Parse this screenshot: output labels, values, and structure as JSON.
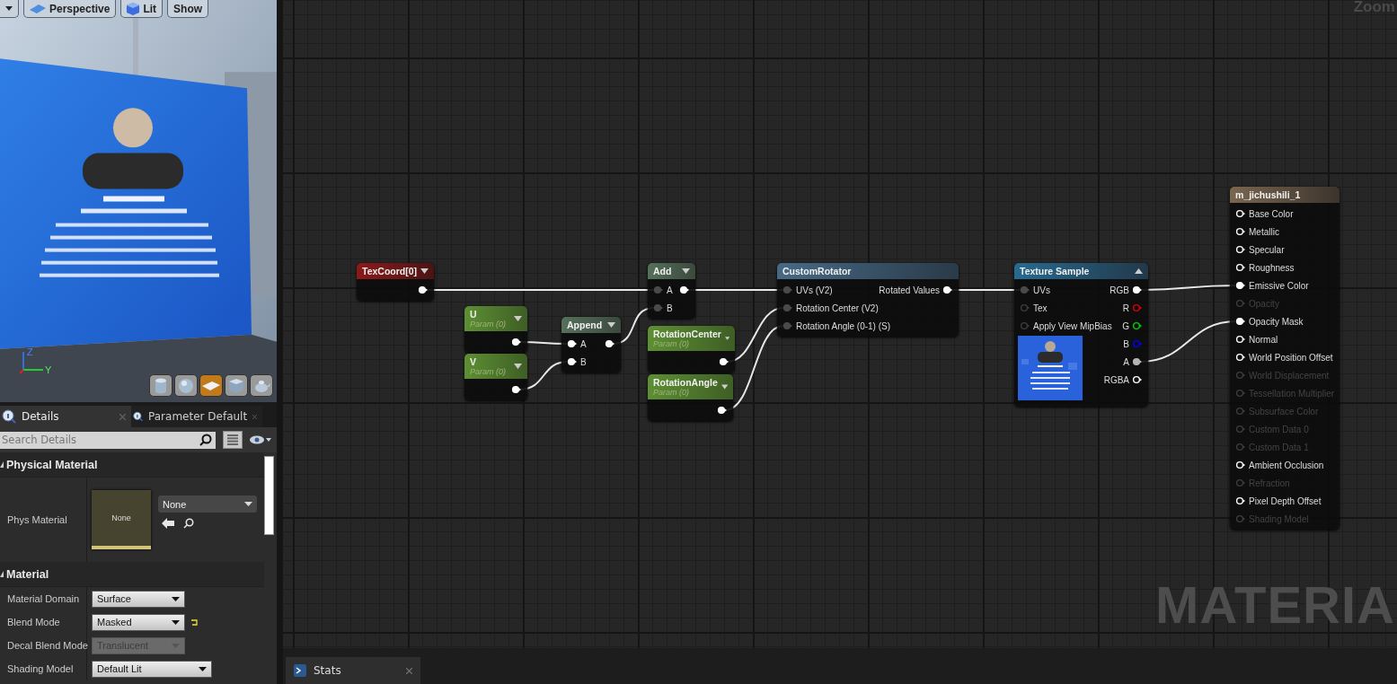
{
  "viewport": {
    "toolbar": [
      {
        "kind": "menu"
      },
      {
        "kind": "view",
        "label": "Perspective"
      },
      {
        "kind": "lighting",
        "label": "Lit"
      },
      {
        "kind": "show",
        "label": "Show"
      }
    ],
    "axis_labels": [
      "Z",
      "Y"
    ],
    "preview_shapes": [
      {
        "kind": "cylinder",
        "selected": false
      },
      {
        "kind": "sphere",
        "selected": false
      },
      {
        "kind": "plane",
        "selected": true
      },
      {
        "kind": "cube",
        "selected": false
      },
      {
        "kind": "teapot",
        "selected": false
      }
    ]
  },
  "details": {
    "tabs": [
      {
        "label": "Details",
        "selected": true
      },
      {
        "label": "Parameter Default",
        "selected": false
      }
    ],
    "search": {
      "placeholder": "Search Details"
    },
    "sections": [
      {
        "title": "Physical Material",
        "rows": [
          {
            "kind": "asset",
            "label": "Phys Material",
            "thumbnail": "None",
            "value": "None"
          }
        ]
      },
      {
        "title": "Material",
        "rows": [
          {
            "kind": "dropdown",
            "label": "Material Domain",
            "value": "Surface",
            "disabled": false,
            "modified": false
          },
          {
            "kind": "dropdown",
            "label": "Blend Mode",
            "value": "Masked",
            "disabled": false,
            "modified": true
          },
          {
            "kind": "dropdown",
            "label": "Decal Blend Mode",
            "value": "Translucent",
            "disabled": true,
            "modified": false
          },
          {
            "kind": "dropdown",
            "label": "Shading Model",
            "value": "Default Lit",
            "disabled": false,
            "modified": false
          }
        ]
      }
    ]
  },
  "graph": {
    "zoom_label": "Zoom",
    "watermark": "MATERIA",
    "nodes": [
      {
        "kind": "coordinate",
        "title": "TexCoord[0]",
        "expanded": false,
        "outputs": [
          {
            "filled": true,
            "dim": false
          }
        ]
      },
      {
        "kind": "parameter",
        "title": "U",
        "subtitle": "Param (0)",
        "expanded": false,
        "outputs": [
          {
            "filled": true,
            "dim": false
          }
        ]
      },
      {
        "kind": "parameter",
        "title": "V",
        "subtitle": "Param (0)",
        "expanded": false,
        "outputs": [
          {
            "filled": true,
            "dim": false
          }
        ]
      },
      {
        "kind": "math",
        "title": "Append",
        "expanded": false,
        "inputs": [
          {
            "label": "A",
            "filled": true,
            "dim": false
          },
          {
            "label": "B",
            "filled": true,
            "dim": false
          }
        ],
        "outputs": [
          {
            "filled": true,
            "dim": false
          }
        ]
      },
      {
        "kind": "math",
        "title": "Add",
        "expanded": false,
        "inputs": [
          {
            "label": "A",
            "filled": true,
            "dim": true
          },
          {
            "label": "B",
            "filled": true,
            "dim": true
          }
        ],
        "outputs": [
          {
            "filled": true,
            "dim": false
          }
        ]
      },
      {
        "kind": "parameter",
        "title": "RotationCenter",
        "subtitle": "Param (0)",
        "expanded": false,
        "outputs": [
          {
            "filled": true,
            "dim": false
          }
        ]
      },
      {
        "kind": "parameter",
        "title": "RotationAngle",
        "subtitle": "Param (0)",
        "expanded": false,
        "outputs": [
          {
            "filled": true,
            "dim": false
          }
        ]
      },
      {
        "kind": "function",
        "title": "CustomRotator",
        "inputs": [
          {
            "label": "UVs (V2)",
            "filled": true,
            "dim": true
          },
          {
            "label": "Rotation Center (V2)",
            "filled": true,
            "dim": true
          },
          {
            "label": "Rotation Angle (0-1) (S)",
            "filled": true,
            "dim": true
          }
        ],
        "outputs": [
          {
            "label": "Rotated Values",
            "filled": true,
            "dim": false
          }
        ]
      },
      {
        "kind": "texture",
        "title": "Texture Sample",
        "expanded": true,
        "inputs": [
          {
            "label": "UVs",
            "filled": true,
            "dim": true
          },
          {
            "label": "Tex",
            "filled": false,
            "dim": true
          },
          {
            "label": "Apply View MipBias",
            "filled": false,
            "dim": true
          }
        ],
        "outputs": [
          {
            "label": "RGB",
            "filled": true,
            "dim": false,
            "color": "#ffffff"
          },
          {
            "label": "R",
            "filled": false,
            "dim": false,
            "color": "#e00000"
          },
          {
            "label": "G",
            "filled": false,
            "dim": false,
            "color": "#00d000"
          },
          {
            "label": "B",
            "filled": false,
            "dim": false,
            "color": "#0000ff"
          },
          {
            "label": "A",
            "filled": true,
            "dim": false,
            "color": "#b4b4b4"
          },
          {
            "label": "RGBA",
            "filled": false,
            "dim": false,
            "color": "#ffffff"
          }
        ]
      },
      {
        "kind": "result",
        "title": "m_jichushili_1",
        "inputs": [
          {
            "label": "Base Color",
            "filled": false,
            "dim": false,
            "enabled": true
          },
          {
            "label": "Metallic",
            "filled": false,
            "dim": false,
            "enabled": true
          },
          {
            "label": "Specular",
            "filled": false,
            "dim": false,
            "enabled": true
          },
          {
            "label": "Roughness",
            "filled": false,
            "dim": false,
            "enabled": true
          },
          {
            "label": "Emissive Color",
            "filled": true,
            "dim": false,
            "enabled": true
          },
          {
            "label": "Opacity",
            "filled": false,
            "dim": true,
            "enabled": false
          },
          {
            "label": "Opacity Mask",
            "filled": true,
            "dim": false,
            "enabled": true
          },
          {
            "label": "Normal",
            "filled": false,
            "dim": false,
            "enabled": true
          },
          {
            "label": "World Position Offset",
            "filled": false,
            "dim": false,
            "enabled": true
          },
          {
            "label": "World Displacement",
            "filled": false,
            "dim": true,
            "enabled": false
          },
          {
            "label": "Tessellation Multiplier",
            "filled": false,
            "dim": true,
            "enabled": false
          },
          {
            "label": "Subsurface Color",
            "filled": false,
            "dim": true,
            "enabled": false
          },
          {
            "label": "Custom Data 0",
            "filled": false,
            "dim": true,
            "enabled": false
          },
          {
            "label": "Custom Data 1",
            "filled": false,
            "dim": true,
            "enabled": false
          },
          {
            "label": "Ambient Occlusion",
            "filled": false,
            "dim": false,
            "enabled": true
          },
          {
            "label": "Refraction",
            "filled": false,
            "dim": true,
            "enabled": false
          },
          {
            "label": "Pixel Depth Offset",
            "filled": false,
            "dim": false,
            "enabled": true
          },
          {
            "label": "Shading Model",
            "filled": false,
            "dim": true,
            "enabled": false
          }
        ]
      }
    ]
  },
  "bottom_tabs": [
    {
      "label": "Stats",
      "selected": true
    }
  ]
}
